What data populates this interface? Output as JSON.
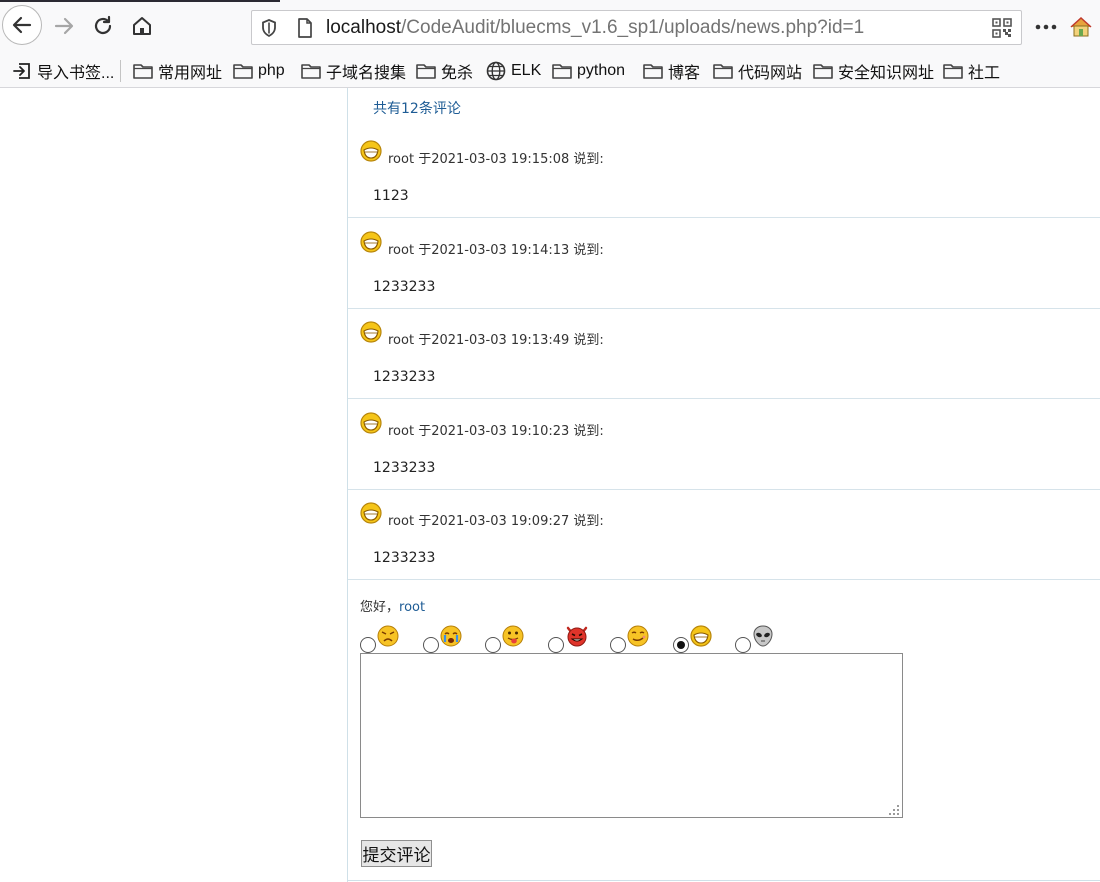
{
  "browser": {
    "url_host": "localhost",
    "url_path": "/CodeAudit/bluecms_v1.6_sp1/uploads/news.php?id=1",
    "icons": [
      "back-icon",
      "forward-icon",
      "reload-icon",
      "home-icon",
      "shield-icon",
      "page-icon",
      "qr-code-icon",
      "more-icon",
      "home-addon-icon"
    ]
  },
  "bookmarks": [
    {
      "label": "导入书签...",
      "icon": "import-icon"
    },
    {
      "label": "常用网址",
      "icon": "folder-icon"
    },
    {
      "label": "php",
      "icon": "folder-icon"
    },
    {
      "label": "子域名搜集",
      "icon": "folder-icon"
    },
    {
      "label": "免杀",
      "icon": "folder-icon"
    },
    {
      "label": "ELK",
      "icon": "globe-icon"
    },
    {
      "label": "python",
      "icon": "folder-icon"
    },
    {
      "label": "博客",
      "icon": "folder-icon"
    },
    {
      "label": "代码网站",
      "icon": "folder-icon"
    },
    {
      "label": "安全知识网址",
      "icon": "folder-icon"
    },
    {
      "label": "社工",
      "icon": "folder-icon"
    }
  ],
  "page": {
    "comment_count_text": "共有12条评论",
    "comments": [
      {
        "meta": "root 于2021-03-03 19:15:08 说到:",
        "body": "1123"
      },
      {
        "meta": "root 于2021-03-03 19:14:13 说到:",
        "body": "1233233"
      },
      {
        "meta": "root 于2021-03-03 19:13:49 说到:",
        "body": "1233233"
      },
      {
        "meta": "root 于2021-03-03 19:10:23 说到:",
        "body": "1233233"
      },
      {
        "meta": "root 于2021-03-03 19:09:27 说到:",
        "body": "1233233"
      }
    ],
    "greeting_prefix": "您好，",
    "greeting_user": "root",
    "emoticons": [
      {
        "icon": "angry-face-icon",
        "selected": false
      },
      {
        "icon": "crying-face-icon",
        "selected": false
      },
      {
        "icon": "tongue-face-icon",
        "selected": false
      },
      {
        "icon": "devil-face-icon",
        "selected": false
      },
      {
        "icon": "smirk-face-icon",
        "selected": false
      },
      {
        "icon": "grin-face-icon",
        "selected": true
      },
      {
        "icon": "alien-face-icon",
        "selected": false
      }
    ],
    "comment_input_value": "",
    "submit_label": "提交评论"
  },
  "colors": {
    "link_blue": "#1e5c95",
    "divider": "#d6e3ea",
    "chrome_bg": "#f9f9fa"
  }
}
